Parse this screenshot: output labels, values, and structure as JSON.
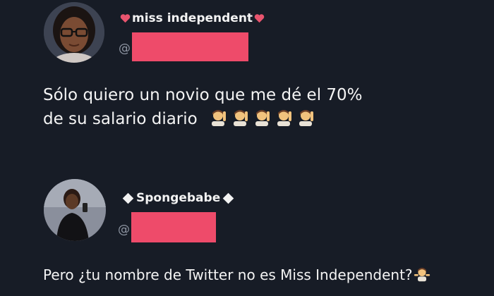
{
  "tweets": [
    {
      "display_name": "miss independent",
      "handle_prefix": "@",
      "text_line1": "Sólo quiero un novio que me dé el 70%",
      "text_line2": "de su salario diario",
      "emoji_icon": "woman-raising-hand-emoji",
      "emoji_count": 5,
      "accent_color": "#e8546e"
    },
    {
      "display_name": "Spongebabe",
      "handle_prefix": "@",
      "text": "Pero ¿tu nombre de Twitter no es Miss Independent?",
      "emoji_icon": "person-shrugging-emoji"
    }
  ],
  "colors": {
    "background": "#171c26",
    "redaction": "#ee4b6a",
    "text": "#f4f4f4",
    "handle": "#8f96a3"
  }
}
